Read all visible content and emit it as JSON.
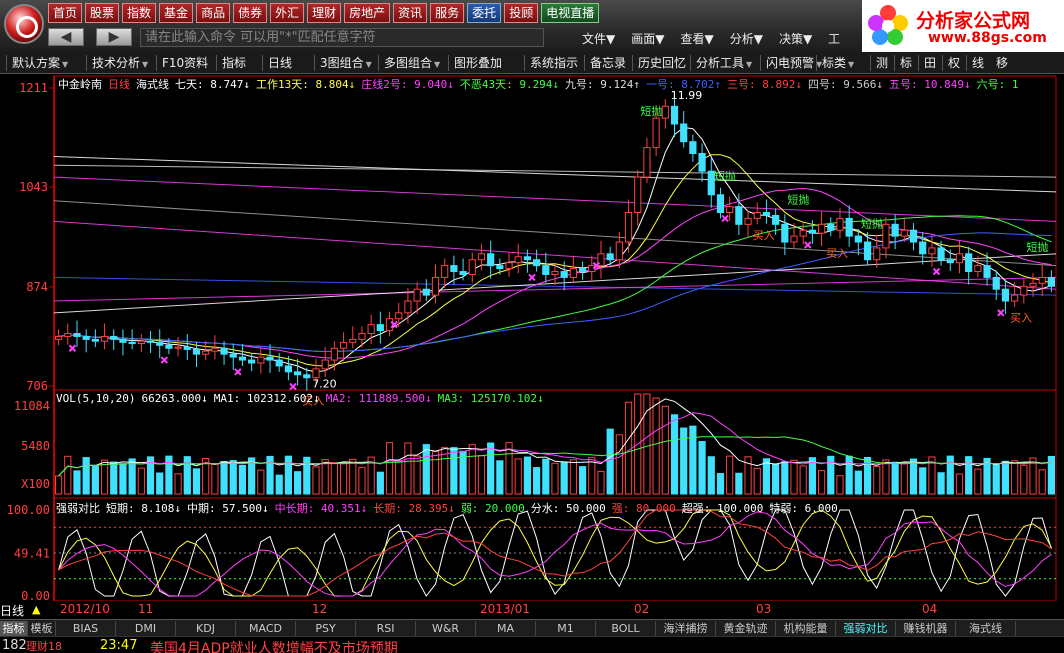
{
  "nav": {
    "buttons": [
      "首页",
      "股票",
      "指数",
      "基金",
      "商品",
      "债券",
      "外汇",
      "理财",
      "房地产",
      "资讯",
      "服务",
      "委托",
      "投顾",
      "电视直播"
    ],
    "back_label": "◀",
    "forward_label": "▶",
    "command_placeholder": "请在此输入命令  可以用\"*\"匹配任意字符",
    "menus": [
      "文件▼",
      "画面▼",
      "查看▼",
      "分析▼",
      "决策▼",
      "工"
    ]
  },
  "brand": {
    "title": "分析家公式网",
    "url": "www.88gs.com"
  },
  "toolbar": {
    "items": [
      "默认方案",
      "技术分析",
      "F10资料",
      "指标",
      "日线",
      "3图组合",
      "多图组合",
      "图形叠加",
      "系统指示",
      "备忘录",
      "历史回忆",
      "分析工具",
      "闪电预警",
      "标类",
      "测",
      "标",
      "田",
      "权",
      "线",
      "移"
    ]
  },
  "colors": {
    "up": "#ff4040",
    "down": "#40e0ff",
    "ma_white": "#ffffff",
    "ma_yellow": "#ffff40",
    "ma_magenta": "#ff40ff",
    "ma_green": "#40ff40",
    "ma_blue": "#4060ff",
    "axis": "#c00000"
  },
  "main_info": [
    {
      "text": "中金岭南",
      "color": "#ffffff"
    },
    {
      "text": "日线",
      "color": "#ff4040"
    },
    {
      "text": "海式线",
      "color": "#ffffff"
    },
    {
      "text": "七天: 8.747↓",
      "color": "#ffffff"
    },
    {
      "text": "工作13天: 8.804↓",
      "color": "#ffff40"
    },
    {
      "text": "庄线2号: 9.040↓",
      "color": "#ff40ff"
    },
    {
      "text": "不恶43天: 9.294↓",
      "color": "#40ff40"
    },
    {
      "text": "九号: 9.124↑",
      "color": "#dddddd"
    },
    {
      "text": "一号: 8.702↑",
      "color": "#4060ff"
    },
    {
      "text": "三号: 8.892↓",
      "color": "#ff4040"
    },
    {
      "text": "四号: 9.566↓",
      "color": "#cccccc"
    },
    {
      "text": "五号: 10.849↓",
      "color": "#ff40ff"
    },
    {
      "text": "六号: 1",
      "color": "#40ff40"
    }
  ],
  "price_axis": [
    "1211",
    "1043",
    "874",
    "706"
  ],
  "annotations": {
    "high": "11.99",
    "low": "7.20",
    "sell": "短抛",
    "buy": "买入"
  },
  "vol_info": [
    {
      "text": "VOL(5,10,20)",
      "color": "#ffffff"
    },
    {
      "text": "66263.000↓",
      "color": "#ffffff"
    },
    {
      "text": "MA1: 102312.602↓",
      "color": "#ffffff"
    },
    {
      "text": "MA2: 111889.500↓",
      "color": "#ff40ff"
    },
    {
      "text": "MA3: 125170.102↓",
      "color": "#40ff40"
    }
  ],
  "vol_axis": [
    "11084",
    "5480",
    "X100"
  ],
  "osc_info": [
    {
      "text": "强弱对比",
      "color": "#ffffff"
    },
    {
      "text": "短期: 8.108↓",
      "color": "#ffffff"
    },
    {
      "text": "中期: 57.500↓",
      "color": "#ffffff"
    },
    {
      "text": "中长期: 40.351↓",
      "color": "#ff40ff"
    },
    {
      "text": "长期: 28.395↓",
      "color": "#ff4040"
    },
    {
      "text": "弱: 20.000",
      "color": "#40ff40"
    },
    {
      "text": "分水: 50.000",
      "color": "#ffffff"
    },
    {
      "text": "强: 80.000",
      "color": "#ff4040"
    },
    {
      "text": "超强: 100.000",
      "color": "#ffffff"
    },
    {
      "text": "特弱: 6.000",
      "color": "#ffffff"
    }
  ],
  "osc_axis": [
    "100.00",
    "49.41",
    "0.00"
  ],
  "dates": [
    "日线",
    "2012/10",
    "11",
    "12",
    "2013/01",
    "02",
    "03",
    "04"
  ],
  "indicator_tabs": [
    "指标",
    "模板",
    "BIAS",
    "DMI",
    "KDJ",
    "MACD",
    "PSY",
    "RSI",
    "W&R",
    "MA",
    "M1",
    "BOLL",
    "海洋捕捞",
    "黄金轨迹",
    "机构能量",
    "强弱对比",
    "赚钱机器",
    "海式线"
  ],
  "status": {
    "left": "182",
    "label": "理财18",
    "time": "23:47",
    "news": "美国4月ADP就业人数增幅不及市场预期"
  },
  "chart_data": {
    "type": "candlestick",
    "title": "中金岭南 日线",
    "y_range": [
      7.06,
      12.11
    ],
    "ticks": [
      12.11,
      10.43,
      8.74,
      7.06
    ],
    "high_label": 11.99,
    "low_label": 7.2,
    "close": [
      7.9,
      7.95,
      7.9,
      7.85,
      7.82,
      7.9,
      7.85,
      7.8,
      7.78,
      7.82,
      7.8,
      7.75,
      7.7,
      7.72,
      7.68,
      7.6,
      7.65,
      7.7,
      7.6,
      7.55,
      7.5,
      7.45,
      7.55,
      7.5,
      7.4,
      7.3,
      7.25,
      7.2,
      7.35,
      7.5,
      7.7,
      7.8,
      7.85,
      7.95,
      8.1,
      8.0,
      8.2,
      8.3,
      8.5,
      8.7,
      8.6,
      8.9,
      9.1,
      9.0,
      8.95,
      9.2,
      9.3,
      9.1,
      9.05,
      9.15,
      9.25,
      9.2,
      9.1,
      8.95,
      9.0,
      8.9,
      9.05,
      9.0,
      9.1,
      9.3,
      9.2,
      9.5,
      10.0,
      10.6,
      11.1,
      11.6,
      11.8,
      11.5,
      11.2,
      11.0,
      10.7,
      10.3,
      10.0,
      10.1,
      9.8,
      9.9,
      10.0,
      9.95,
      9.8,
      9.5,
      9.6,
      9.7,
      9.65,
      9.8,
      9.7,
      9.9,
      9.6,
      9.5,
      9.2,
      9.4,
      9.8,
      9.6,
      9.7,
      9.5,
      9.3,
      9.4,
      9.2,
      9.15,
      9.3,
      9.0,
      9.1,
      8.9,
      8.7,
      8.5,
      8.6,
      8.75,
      8.8,
      8.9,
      8.75
    ],
    "volume_max": 11084,
    "oscillator_range": [
      0,
      100
    ]
  }
}
